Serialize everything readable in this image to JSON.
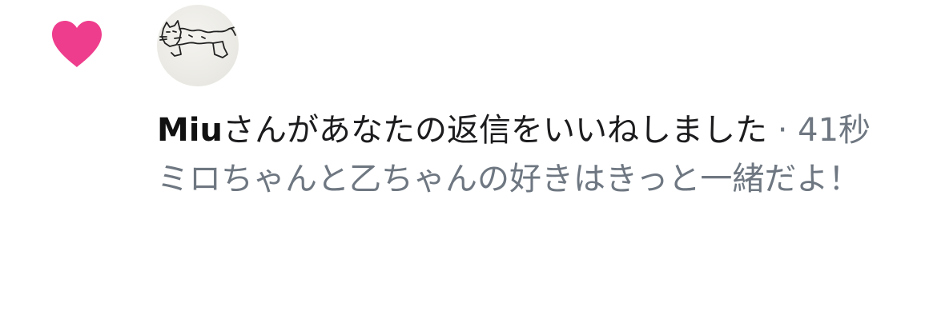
{
  "notification": {
    "type_icon": "heart-icon",
    "heart_color": "#ef3d8d",
    "avatar_icon": "cat-drawing-avatar",
    "username": "Miu",
    "action": "さんがあなたの返信をいいねしました",
    "separator": " · ",
    "timestamp": "41秒",
    "reply_text": "ミロちゃんと乙ちゃんの好きはきっと一緒だよ！",
    "colors": {
      "primary_text": "#1c1c1e",
      "secondary_text": "#6e7781"
    }
  }
}
